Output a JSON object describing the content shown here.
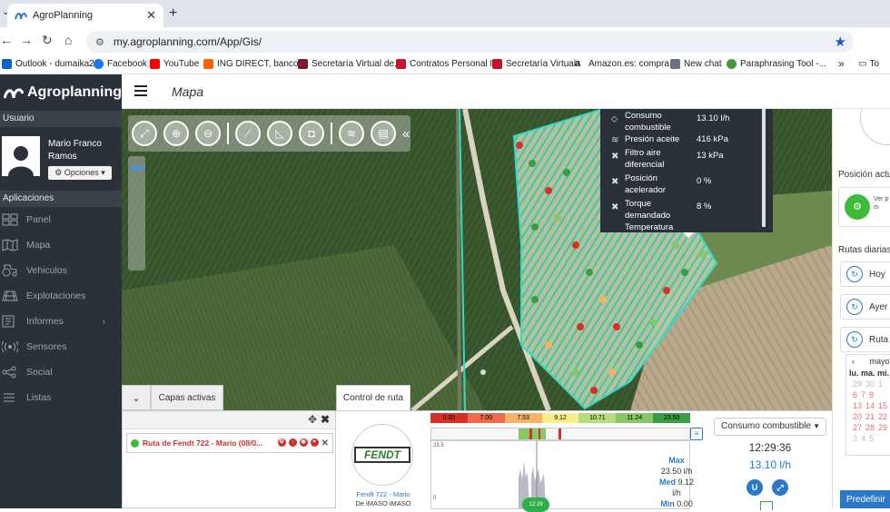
{
  "browser": {
    "tab_title": "AgroPlanning",
    "url": "my.agroplanning.com/App/Gis/",
    "bookmarks": [
      {
        "label": "Outlook - dumaika2...",
        "color": "#0a64c8"
      },
      {
        "label": "Facebook",
        "color": "#1877f2"
      },
      {
        "label": "YouTube",
        "color": "#ff0000"
      },
      {
        "label": "ING DIRECT, banco...",
        "color": "#ff6200"
      },
      {
        "label": "Secretaría Virtual de...",
        "color": "#7a1c2b"
      },
      {
        "label": "Contratos Personal I...",
        "color": "#c8102e"
      },
      {
        "label": "Secretaría Virtual",
        "color": "#c8102e"
      },
      {
        "label": "Amazon.es: compra...",
        "color": "#111111"
      },
      {
        "label": "New chat",
        "color": "#6b7280"
      },
      {
        "label": "Paraphrasing Tool -...",
        "color": "#3e9b3e"
      }
    ],
    "bookmarks_overflow": "»",
    "bookmarks_folder": "To"
  },
  "app": {
    "brand": "Agroplanning",
    "page_title": "Mapa",
    "user_section": "Usuario",
    "user_name": "Mario Franco Ramos",
    "options_label": "⚙ Opciones ▾",
    "apps_section": "Aplicaciones",
    "menu": [
      {
        "label": "Panel",
        "icon": "grid-icon"
      },
      {
        "label": "Mapa",
        "icon": "map-icon"
      },
      {
        "label": "Vehiculos",
        "icon": "tractor-icon"
      },
      {
        "label": "Explotaciones",
        "icon": "field-icon"
      },
      {
        "label": "Informes",
        "icon": "report-icon",
        "arrow": "›"
      },
      {
        "label": "Sensores",
        "icon": "sensor-icon"
      },
      {
        "label": "Social",
        "icon": "share-icon"
      },
      {
        "label": "Listas",
        "icon": "list-icon"
      }
    ]
  },
  "tooltip": {
    "rows": [
      {
        "label": "Consumo combustible",
        "value": "13.10 l/h",
        "icon": "fuel-icon"
      },
      {
        "label": "Presión aceite",
        "value": "416 kPa",
        "icon": "pressure-icon"
      },
      {
        "label": "Filtro aire diferencial",
        "value": "13 kPa",
        "icon": "wrench-icon"
      },
      {
        "label": "Posición acelerador",
        "value": "0 %",
        "icon": "wrench-icon"
      },
      {
        "label": "Torque demandado",
        "value": "8 %",
        "icon": "wrench-icon"
      },
      {
        "label": "Temperatura",
        "value": "",
        "icon": ""
      }
    ]
  },
  "right_panel": {
    "position_title": "Posición actual",
    "position_text": "Ver p el m",
    "routes_title": "Rutas diarias",
    "routes": [
      "Hoy",
      "Ayer",
      "Ruta d"
    ],
    "calendar": {
      "month": "mayo",
      "prev": "‹",
      "weekdays": "lu. ma. mi.",
      "rows": [
        [
          "29",
          "30",
          "1"
        ],
        [
          "6",
          "7",
          "8"
        ],
        [
          "13",
          "14",
          "15"
        ],
        [
          "20",
          "21",
          "22"
        ],
        [
          "27",
          "28",
          "29"
        ],
        [
          "3",
          "4",
          "5"
        ]
      ]
    },
    "predefined": "Predefinir"
  },
  "layers": {
    "tab_label": "Capas activas",
    "layer_name": "Ruta de Fendt 722 - Mario (08/0...",
    "move_icon": "✥",
    "close_icon": "✖"
  },
  "route": {
    "tab_label": "Control de ruta",
    "vehicle_brand": "FENDT",
    "vehicle_name": "Fendt 722 - Mario",
    "vehicle_sub": "De iMASO iMASO",
    "scale": [
      {
        "v": "0.00",
        "c": "#d73027"
      },
      {
        "v": "7.00",
        "c": "#ec6b4d"
      },
      {
        "v": "7.53",
        "c": "#f7b267"
      },
      {
        "v": "9.12",
        "c": "#fbef8a"
      },
      {
        "v": "10.71",
        "c": "#b5dd80"
      },
      {
        "v": "11.24",
        "c": "#86c76a"
      },
      {
        "v": "23.50",
        "c": "#3a9d46"
      }
    ],
    "chart_max_label": "23.5",
    "chart_zero_label": "0",
    "chart_time": "12:29",
    "stats": {
      "max_label": "Max",
      "max_value": "23.50 l/h",
      "med_label": "Med",
      "med_value": "9.12",
      "med_unit": "l/h",
      "min_label": "Min",
      "min_value": "0.00"
    },
    "select_value": "Consumo combustible",
    "time": "12:29:36",
    "rate": "13.10 l/h"
  }
}
